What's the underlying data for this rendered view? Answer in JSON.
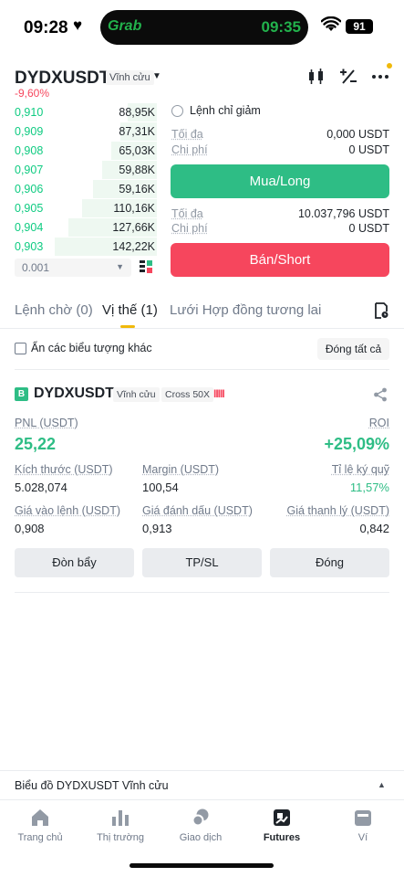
{
  "status_bar": {
    "time": "09:28",
    "island_app": "Grab",
    "island_time": "09:35",
    "battery": "91"
  },
  "header": {
    "symbol": "DYDXUSDT",
    "contract_tag": "Vĩnh cửu",
    "change": "-9,60%"
  },
  "order_book": {
    "rows": [
      {
        "price": "0,910",
        "qty": "88,95K",
        "depth": 0.26
      },
      {
        "price": "0,909",
        "qty": "87,31K",
        "depth": 0.32
      },
      {
        "price": "0,908",
        "qty": "65,03K",
        "depth": 0.4
      },
      {
        "price": "0,907",
        "qty": "59,88K",
        "depth": 0.48
      },
      {
        "price": "0,906",
        "qty": "59,16K",
        "depth": 0.56
      },
      {
        "price": "0,905",
        "qty": "110,16K",
        "depth": 0.66
      },
      {
        "price": "0,904",
        "qty": "127,66K",
        "depth": 0.78
      },
      {
        "price": "0,903",
        "qty": "142,22K",
        "depth": 0.9
      }
    ],
    "precision": "0.001"
  },
  "order_form": {
    "reduce_only_label": "Lệnh chỉ giảm",
    "long": {
      "max_label": "Tối đa",
      "max_value": "0,000 USDT",
      "cost_label": "Chi phí",
      "cost_value": "0 USDT",
      "button": "Mua/Long"
    },
    "short": {
      "max_label": "Tối đa",
      "max_value": "10.037,796 USDT",
      "cost_label": "Chi phí",
      "cost_value": "0 USDT",
      "button": "Bán/Short"
    }
  },
  "tabs": [
    {
      "label": "Lệnh chờ (0)"
    },
    {
      "label": "Vị thế (1)"
    },
    {
      "label": "Lưới Hợp đồng tương lai"
    }
  ],
  "positions_toolbar": {
    "hide_label": "Ẩn các biểu tượng khác",
    "close_all": "Đóng tất cả"
  },
  "position": {
    "side_badge": "B",
    "symbol": "DYDXUSDT",
    "tag_contract": "Vĩnh cửu",
    "tag_margin": "Cross 50X",
    "risk_bars": "IIIII",
    "pnl_label": "PNL (USDT)",
    "pnl_value": "25,22",
    "roi_label": "ROI",
    "roi_value": "+25,09%",
    "size_label": "Kích thước (USDT)",
    "size_value": "5.028,074",
    "margin_label": "Margin (USDT)",
    "margin_value": "100,54",
    "margin_ratio_label": "Tỉ lệ ký quỹ",
    "margin_ratio_value": "11,57%",
    "entry_label": "Giá vào lệnh (USDT)",
    "entry_value": "0,908",
    "mark_label": "Giá đánh dấu (USDT)",
    "mark_value": "0,913",
    "liq_label": "Giá thanh lý (USDT)",
    "liq_value": "0,842",
    "buttons": {
      "leverage": "Đòn bẩy",
      "tpsl": "TP/SL",
      "close": "Đóng"
    }
  },
  "chart_bar": {
    "label": "Biểu đồ DYDXUSDT Vĩnh cửu"
  },
  "bottom_nav": [
    {
      "label": "Trang chủ",
      "icon": "home-icon"
    },
    {
      "label": "Thị trường",
      "icon": "market-chart-icon"
    },
    {
      "label": "Giao dịch",
      "icon": "trade-icon"
    },
    {
      "label": "Futures",
      "icon": "futures-icon",
      "active": true
    },
    {
      "label": "Ví",
      "icon": "wallet-icon"
    }
  ],
  "colors": {
    "buy": "#2ebd85",
    "sell": "#f6465d",
    "accent": "#f0b90b"
  }
}
